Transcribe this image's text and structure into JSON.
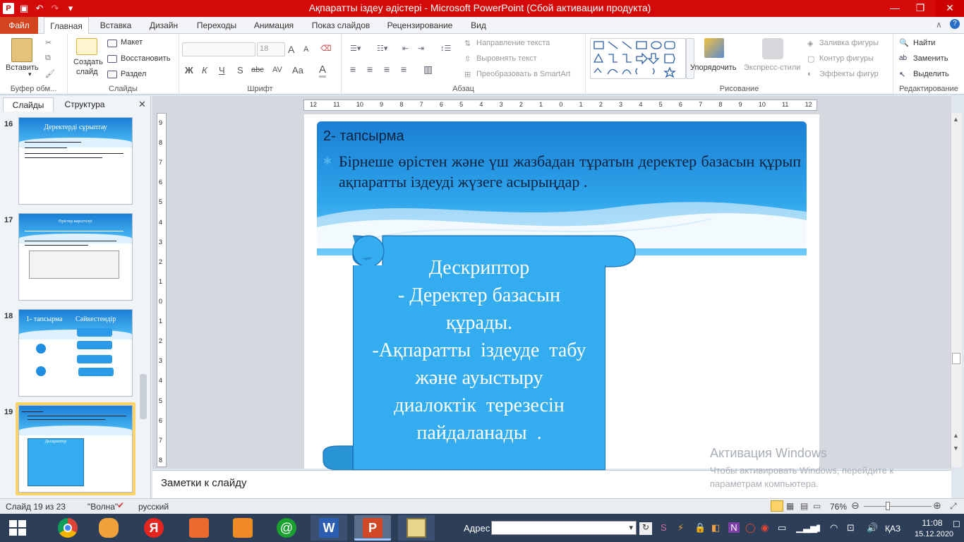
{
  "window": {
    "title": "Ақпаратты іздеу әдістері  -  Microsoft PowerPoint (Сбой активации продукта)",
    "minimize": "—",
    "restore": "❐",
    "close": "✕"
  },
  "ribbon_tabs": [
    "Файл",
    "Главная",
    "Вставка",
    "Дизайн",
    "Переходы",
    "Анимация",
    "Показ слайдов",
    "Рецензирование",
    "Вид"
  ],
  "ribbon": {
    "clipboard": {
      "paste": "Вставить",
      "group": "Буфер обм..."
    },
    "slides": {
      "create": "Создать",
      "create2": "слайд",
      "layout": "Макет",
      "reset": "Восстановить",
      "section": "Раздел",
      "group": "Слайды"
    },
    "font": {
      "size": "18",
      "bold": "Ж",
      "italic": "К",
      "underline": "Ч",
      "strike": "abc",
      "shadow": "S",
      "spacing": "AV",
      "case": "Aa",
      "color": "A",
      "grow": "A",
      "shrink": "A",
      "group": "Шрифт"
    },
    "paragraph": {
      "direction": "Направление текста",
      "align": "Выровнять текст",
      "smartart": "Преобразовать в SmartArt",
      "group": "Абзац"
    },
    "drawing": {
      "arrange": "Упорядочить",
      "styles": "Экспресс-стили",
      "fill": "Заливка фигуры",
      "outline": "Контур фигуры",
      "effects": "Эффекты фигур",
      "group": "Рисование"
    },
    "editing": {
      "find": "Найти",
      "replace": "Заменить",
      "select": "Выделить",
      "group": "Редактирование"
    }
  },
  "left_pane": {
    "tab_slides": "Слайды",
    "tab_outline": "Структура",
    "close": "✕",
    "thumbnails": [
      {
        "num": "16",
        "title": "Деректерді сұрыптау"
      },
      {
        "num": "17",
        "title": "Өрістер көрсетілуі"
      },
      {
        "num": "18",
        "title": "1- тапсырма",
        "title2": "Сәйкестендір"
      },
      {
        "num": "19",
        "title": "Дескриптор"
      }
    ]
  },
  "ruler": {
    "h_ticks": [
      "12",
      "11",
      "10",
      "9",
      "8",
      "7",
      "6",
      "5",
      "4",
      "3",
      "2",
      "1",
      "0",
      "1",
      "2",
      "3",
      "4",
      "5",
      "6",
      "7",
      "8",
      "9",
      "10",
      "11",
      "12"
    ],
    "v_ticks": [
      "9",
      "8",
      "7",
      "6",
      "5",
      "4",
      "3",
      "2",
      "1",
      "0",
      "1",
      "2",
      "3",
      "4",
      "5",
      "6",
      "7",
      "8"
    ]
  },
  "slide": {
    "title": "2- тапсырма",
    "bullet": "Бірнеше өрістен және  үш жазбадан тұратын деректер базасын құрып ақпаратты іздеуді жүзеге асырыңдар .",
    "scroll_lines": [
      "Дескриптор",
      "- Деректер базасын",
      "құрады.",
      "-Ақпаратты  іздеуде  табу",
      "және ауыстыру",
      "диалоктік  терезесін",
      "пайдаланады  ."
    ]
  },
  "notes_placeholder": "Заметки к слайду",
  "activation": {
    "title": "Активация Windows",
    "line1": "Чтобы активировать Windows, перейдите к",
    "line2": "параметрам компьютера."
  },
  "status": {
    "slide_info": "Слайд 19 из 23",
    "theme": "\"Волна\"",
    "language": "русский",
    "zoom": "76%"
  },
  "taskbar": {
    "address_label": "Адрес",
    "lang": "ҚАЗ",
    "time": "11:08",
    "date": "15.12.2020"
  }
}
